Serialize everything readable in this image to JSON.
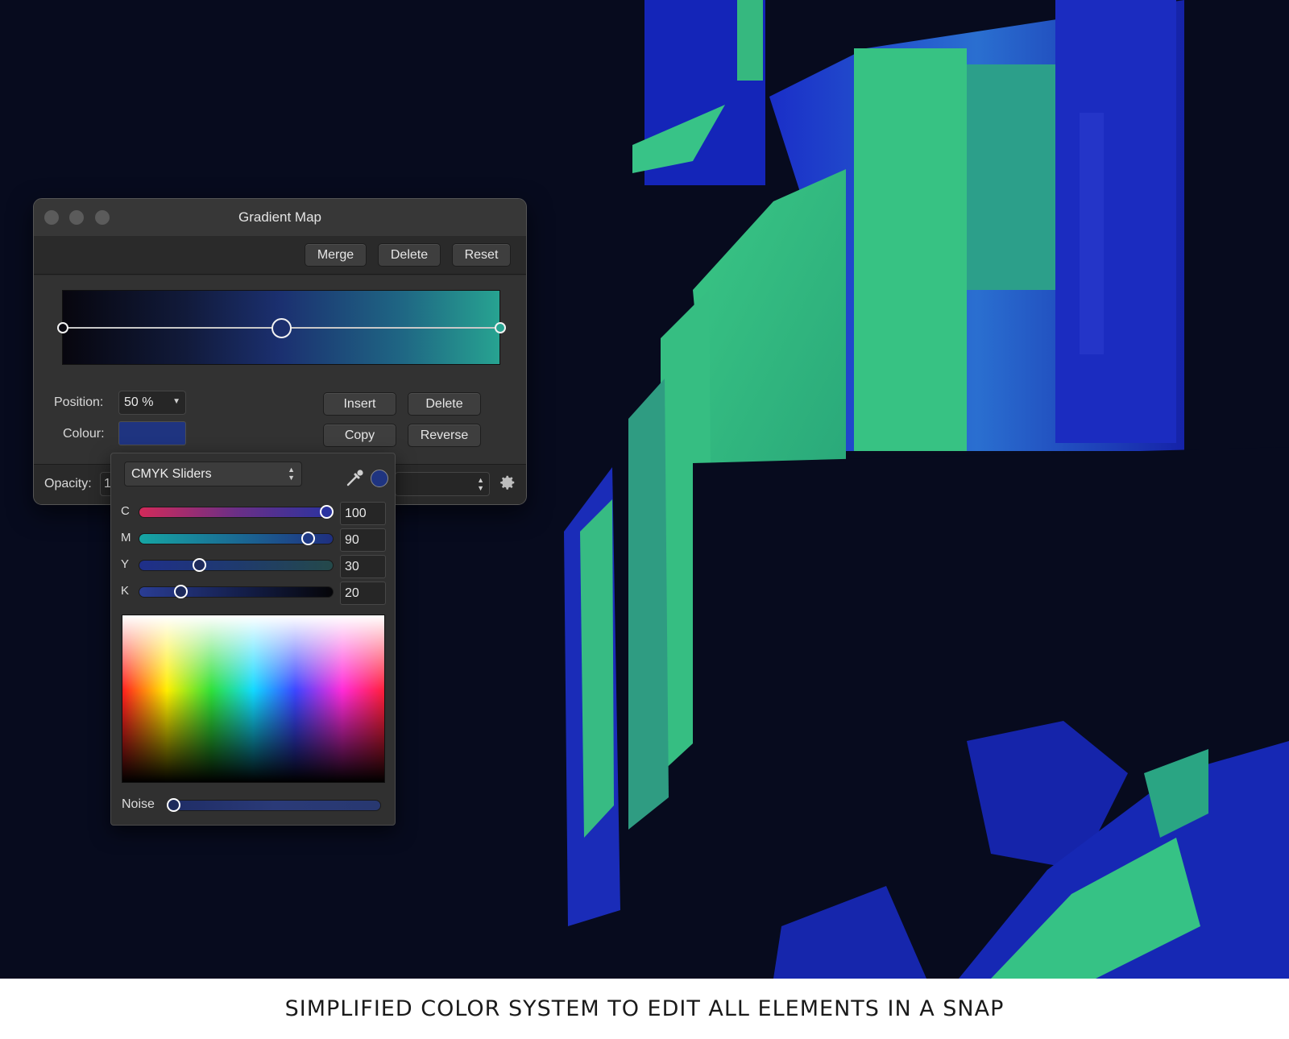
{
  "window": {
    "title": "Gradient Map",
    "toolbar": {
      "merge": "Merge",
      "delete": "Delete",
      "reset": "Reset"
    },
    "position_label": "Position:",
    "position_value": "50 %",
    "colour_label": "Colour:",
    "colour_value": "#1f3480",
    "insert": "Insert",
    "delete_stop": "Delete",
    "copy": "Copy",
    "reverse": "Reverse",
    "opacity_label": "Opacity:",
    "opacity_value_partial": "1"
  },
  "color_popover": {
    "mode": "CMYK Sliders",
    "sliders": [
      {
        "label": "C",
        "value": "100"
      },
      {
        "label": "M",
        "value": "90"
      },
      {
        "label": "Y",
        "value": "30"
      },
      {
        "label": "K",
        "value": "20"
      }
    ],
    "noise_label": "Noise",
    "noise_value": 0
  },
  "caption": "SIMPLIFIED COLOR SYSTEM TO EDIT ALL ELEMENTS IN A SNAP",
  "colors": {
    "scene_bg": "#070b1e",
    "accent_green": "#35c484",
    "accent_blue": "#1a2fc4"
  }
}
